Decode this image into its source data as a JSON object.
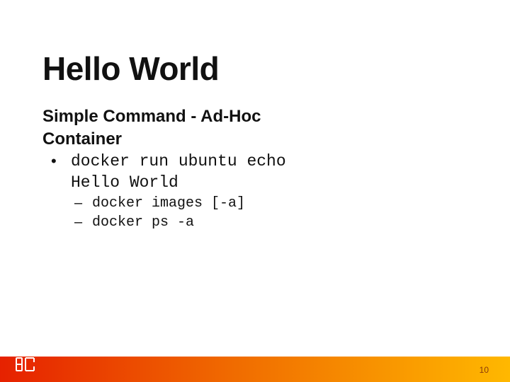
{
  "title": "Hello World",
  "subtitle_line1": "Simple Command - Ad-Hoc",
  "subtitle_line2": "Container",
  "bullets": {
    "l1_line1": "docker run ubuntu echo",
    "l1_line2": "Hello World",
    "l2_a": "docker images [-a]",
    "l2_b": "docker ps -a"
  },
  "page_number": "10"
}
